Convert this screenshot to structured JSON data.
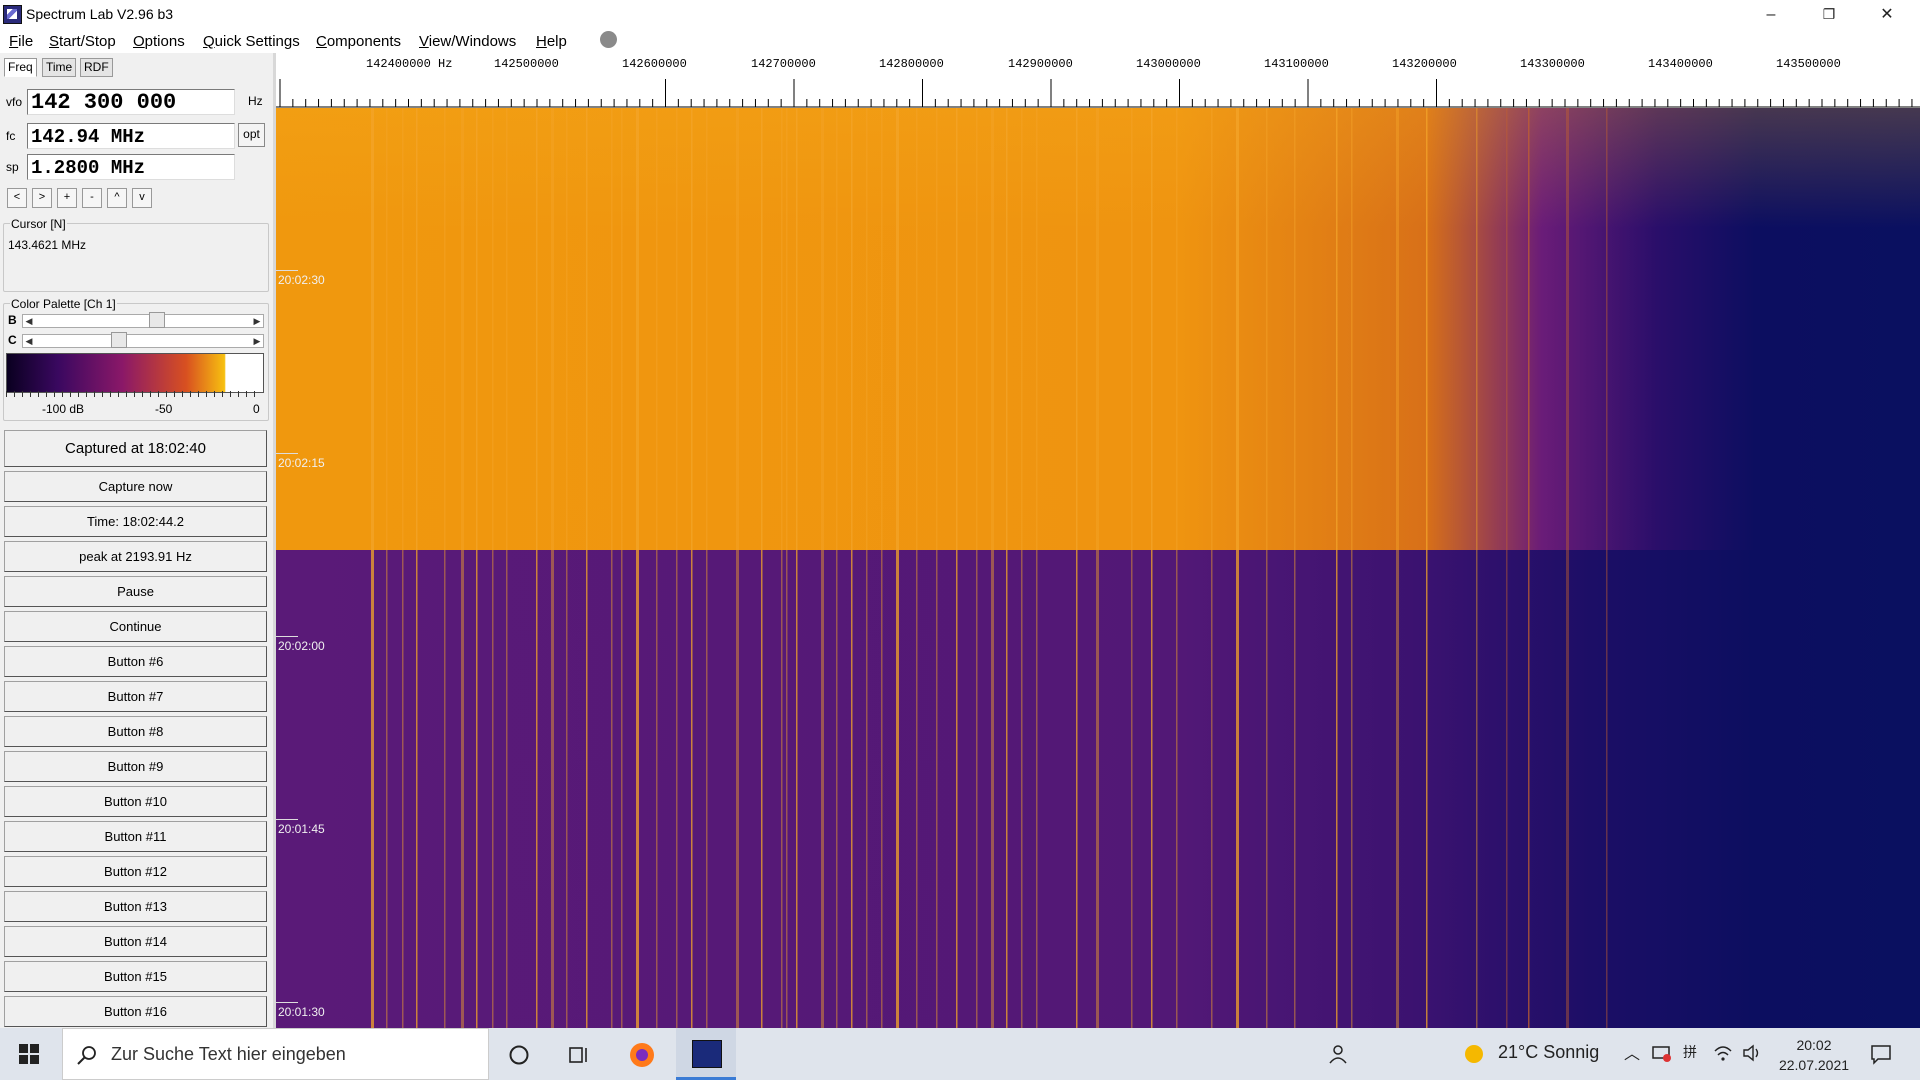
{
  "window": {
    "title": "Spectrum Lab V2.96 b3",
    "controls": {
      "minimize": "–",
      "restore": "❐",
      "close": "✕"
    }
  },
  "menu": {
    "items": [
      {
        "label": "File"
      },
      {
        "label": "Start/Stop"
      },
      {
        "label": "Options"
      },
      {
        "label": "Quick Settings"
      },
      {
        "label": "Components"
      },
      {
        "label": "View/Windows"
      },
      {
        "label": "Help"
      }
    ]
  },
  "panel": {
    "tabs": [
      "Freq",
      "Time",
      "RDF"
    ],
    "vfo": {
      "label": "vfo",
      "value": "142 300 000",
      "unit": "Hz"
    },
    "fc": {
      "label": "fc",
      "value": "142.94 MHz",
      "opt_label": "opt"
    },
    "sp": {
      "label": "sp",
      "value": "1.2800 MHz"
    },
    "nav_buttons": [
      "<",
      ">",
      "+",
      "-",
      "^",
      "v"
    ],
    "cursor": {
      "title": "Cursor [N]",
      "value": "143.4621 MHz"
    },
    "palette": {
      "title": "Color Palette [Ch 1]",
      "b_label": "B",
      "c_label": "C",
      "b_level": 0.56,
      "c_level": 0.4,
      "scale": [
        "-100 dB",
        "-50",
        "0"
      ]
    },
    "buttons": [
      "Captured at 18:02:40",
      "Capture now",
      "Time:  18:02:44.2",
      "peak at 2193.91 Hz",
      "Pause",
      "Continue",
      "Button #6",
      "Button #7",
      "Button #8",
      "Button #9",
      "Button #10",
      "Button #11",
      "Button #12",
      "Button #13",
      "Button #14",
      "Button #15",
      "Button #16"
    ]
  },
  "spectrogram": {
    "freq_labels": [
      "142400000  Hz",
      "142500000",
      "142600000",
      "142700000",
      "142800000",
      "142900000",
      "143000000",
      "143100000",
      "143200000",
      "143300000",
      "143400000",
      "143500000"
    ],
    "time_labels": [
      "20:02:30",
      "20:02:15",
      "20:02:00",
      "20:01:45",
      "20:01:30"
    ],
    "colors": {
      "hot": "#f5a010",
      "mid": "#5a1a78",
      "cold": "#0a1060"
    }
  },
  "taskbar": {
    "search_placeholder": "Zur Suche Text hier eingeben",
    "weather": "21°C  Sonnig",
    "time": "20:02",
    "date": "22.07.2021",
    "icons": [
      "windows-start-icon",
      "search-icon",
      "cortana-icon",
      "task-view-icon",
      "firefox-icon",
      "spectrum-lab-icon",
      "people-icon",
      "weather-sun-icon",
      "chevron-up-icon",
      "network-icon",
      "ime-icon",
      "wifi-icon",
      "volume-icon",
      "notification-icon"
    ]
  }
}
